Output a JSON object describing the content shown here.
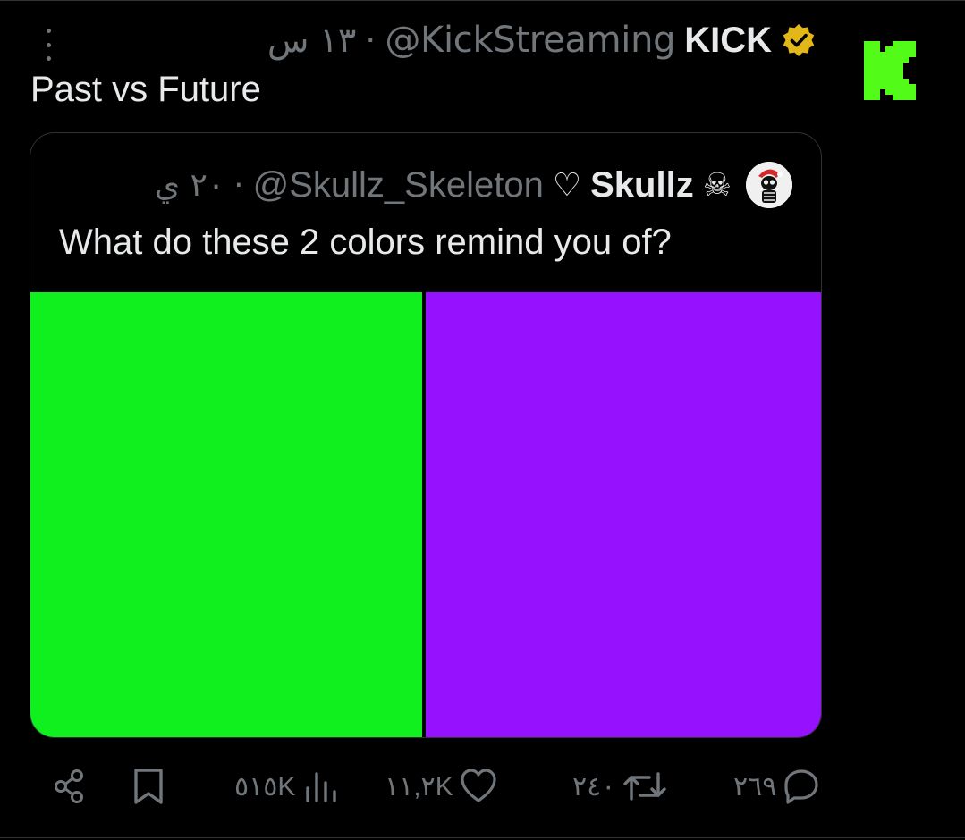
{
  "tweet": {
    "author_name": "KICK",
    "author_handle": "@KickStreaming",
    "separator": "·",
    "time": "١٣ س",
    "text": "Past vs Future"
  },
  "quote": {
    "author_name": "Skullz",
    "author_handle": "@Skullz_Skeleton",
    "heart_glyph": "♡",
    "skull_glyph": "☠",
    "separator": "·",
    "time": "٢٠ ي",
    "text": "What do these 2 colors remind you of?",
    "left_color": "#0ff01e",
    "right_color": "#9612ff"
  },
  "actions": {
    "views": "٥١٥K",
    "likes": "١١,٢K",
    "reposts": "٢٤٠",
    "replies": "٢٦٩"
  },
  "colors": {
    "kick_green": "#53fc18",
    "verified_gold": "#e2b719",
    "muted": "#71767b"
  }
}
